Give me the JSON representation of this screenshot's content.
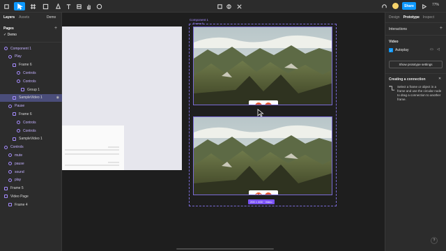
{
  "toolbar": {
    "share_label": "Share",
    "zoom_label": "77%"
  },
  "left_panel": {
    "tabs": [
      "Layers",
      "Assets"
    ],
    "file_name": "Demo",
    "pages_title": "Pages",
    "current_page": "Demo",
    "layers": [
      {
        "label": "Component 1",
        "indent": 0,
        "kind": "comp"
      },
      {
        "label": "Play",
        "indent": 1,
        "kind": "comp"
      },
      {
        "label": "Frame 6",
        "indent": 2,
        "kind": "frame"
      },
      {
        "label": "Controls",
        "indent": 3,
        "kind": "comp"
      },
      {
        "label": "Controls",
        "indent": 3,
        "kind": "comp"
      },
      {
        "label": "Group 1",
        "indent": 4,
        "kind": "frame"
      },
      {
        "label": "SampleVideo 1",
        "indent": 2,
        "kind": "frame",
        "selected": true
      },
      {
        "label": "Pause",
        "indent": 1,
        "kind": "comp"
      },
      {
        "label": "Frame 6",
        "indent": 2,
        "kind": "frame"
      },
      {
        "label": "Controls",
        "indent": 3,
        "kind": "comp"
      },
      {
        "label": "Controls",
        "indent": 3,
        "kind": "comp"
      },
      {
        "label": "SampleVideo 1",
        "indent": 2,
        "kind": "frame"
      },
      {
        "label": "Controls",
        "indent": 0,
        "kind": "comp"
      },
      {
        "label": "mute",
        "indent": 1,
        "kind": "comp"
      },
      {
        "label": "pause",
        "indent": 1,
        "kind": "comp"
      },
      {
        "label": "sound",
        "indent": 1,
        "kind": "comp"
      },
      {
        "label": "play",
        "indent": 1,
        "kind": "comp"
      },
      {
        "label": "Frame 5",
        "indent": 0,
        "kind": "frame"
      },
      {
        "label": "Video Page",
        "indent": 0,
        "kind": "frame"
      },
      {
        "label": "Frame 4",
        "indent": 1,
        "kind": "frame"
      }
    ]
  },
  "canvas": {
    "component_label": "Component 1",
    "frame_label": "Frame 6",
    "size_badge": "200 × 400 · Video"
  },
  "right_panel": {
    "tabs": [
      "Design",
      "Prototype",
      "Inspect"
    ],
    "interactions_label": "Interactions",
    "video_label": "Video",
    "autoplay_label": "Autoplay",
    "settings_button": "Show prototype settings",
    "connection_title": "Creating a connection",
    "connection_text": "Select a frame or object in a frame and use the circular node to drag a connection to another frame."
  },
  "colors": {
    "accent": "#0d99ff",
    "component": "#a58bff",
    "control_button": "#e2552e"
  }
}
